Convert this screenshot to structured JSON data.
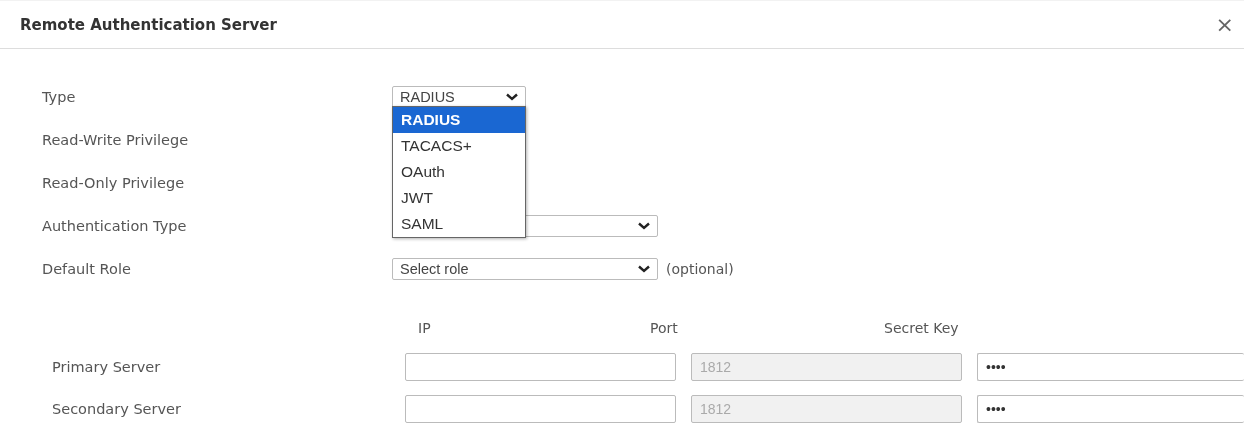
{
  "dialog": {
    "title": "Remote Authentication Server",
    "close": "×"
  },
  "fields": [
    {
      "label": "Type",
      "kind": "select",
      "value": "RADIUS",
      "open": true,
      "options": [
        {
          "label": "RADIUS",
          "selected": true
        },
        {
          "label": "TACACS+",
          "selected": false
        },
        {
          "label": "OAuth",
          "selected": false
        },
        {
          "label": "JWT",
          "selected": false
        },
        {
          "label": "SAML",
          "selected": false
        }
      ]
    },
    {
      "label": "Read-Write Privilege",
      "kind": "hidden"
    },
    {
      "label": "Read-Only Privilege",
      "kind": "hidden"
    },
    {
      "label": "Authentication Type",
      "kind": "select-wide"
    },
    {
      "label": "Default Role",
      "kind": "select-wide",
      "value": "Select role",
      "note": "(optional)"
    }
  ],
  "servers": {
    "columns": [
      "IP",
      "Port",
      "Secret Key"
    ],
    "rows": [
      {
        "label": "Primary Server",
        "ip": "",
        "port": "1812",
        "secret": "••••"
      },
      {
        "label": "Secondary Server",
        "ip": "",
        "port": "1812",
        "secret": "••••"
      }
    ]
  }
}
